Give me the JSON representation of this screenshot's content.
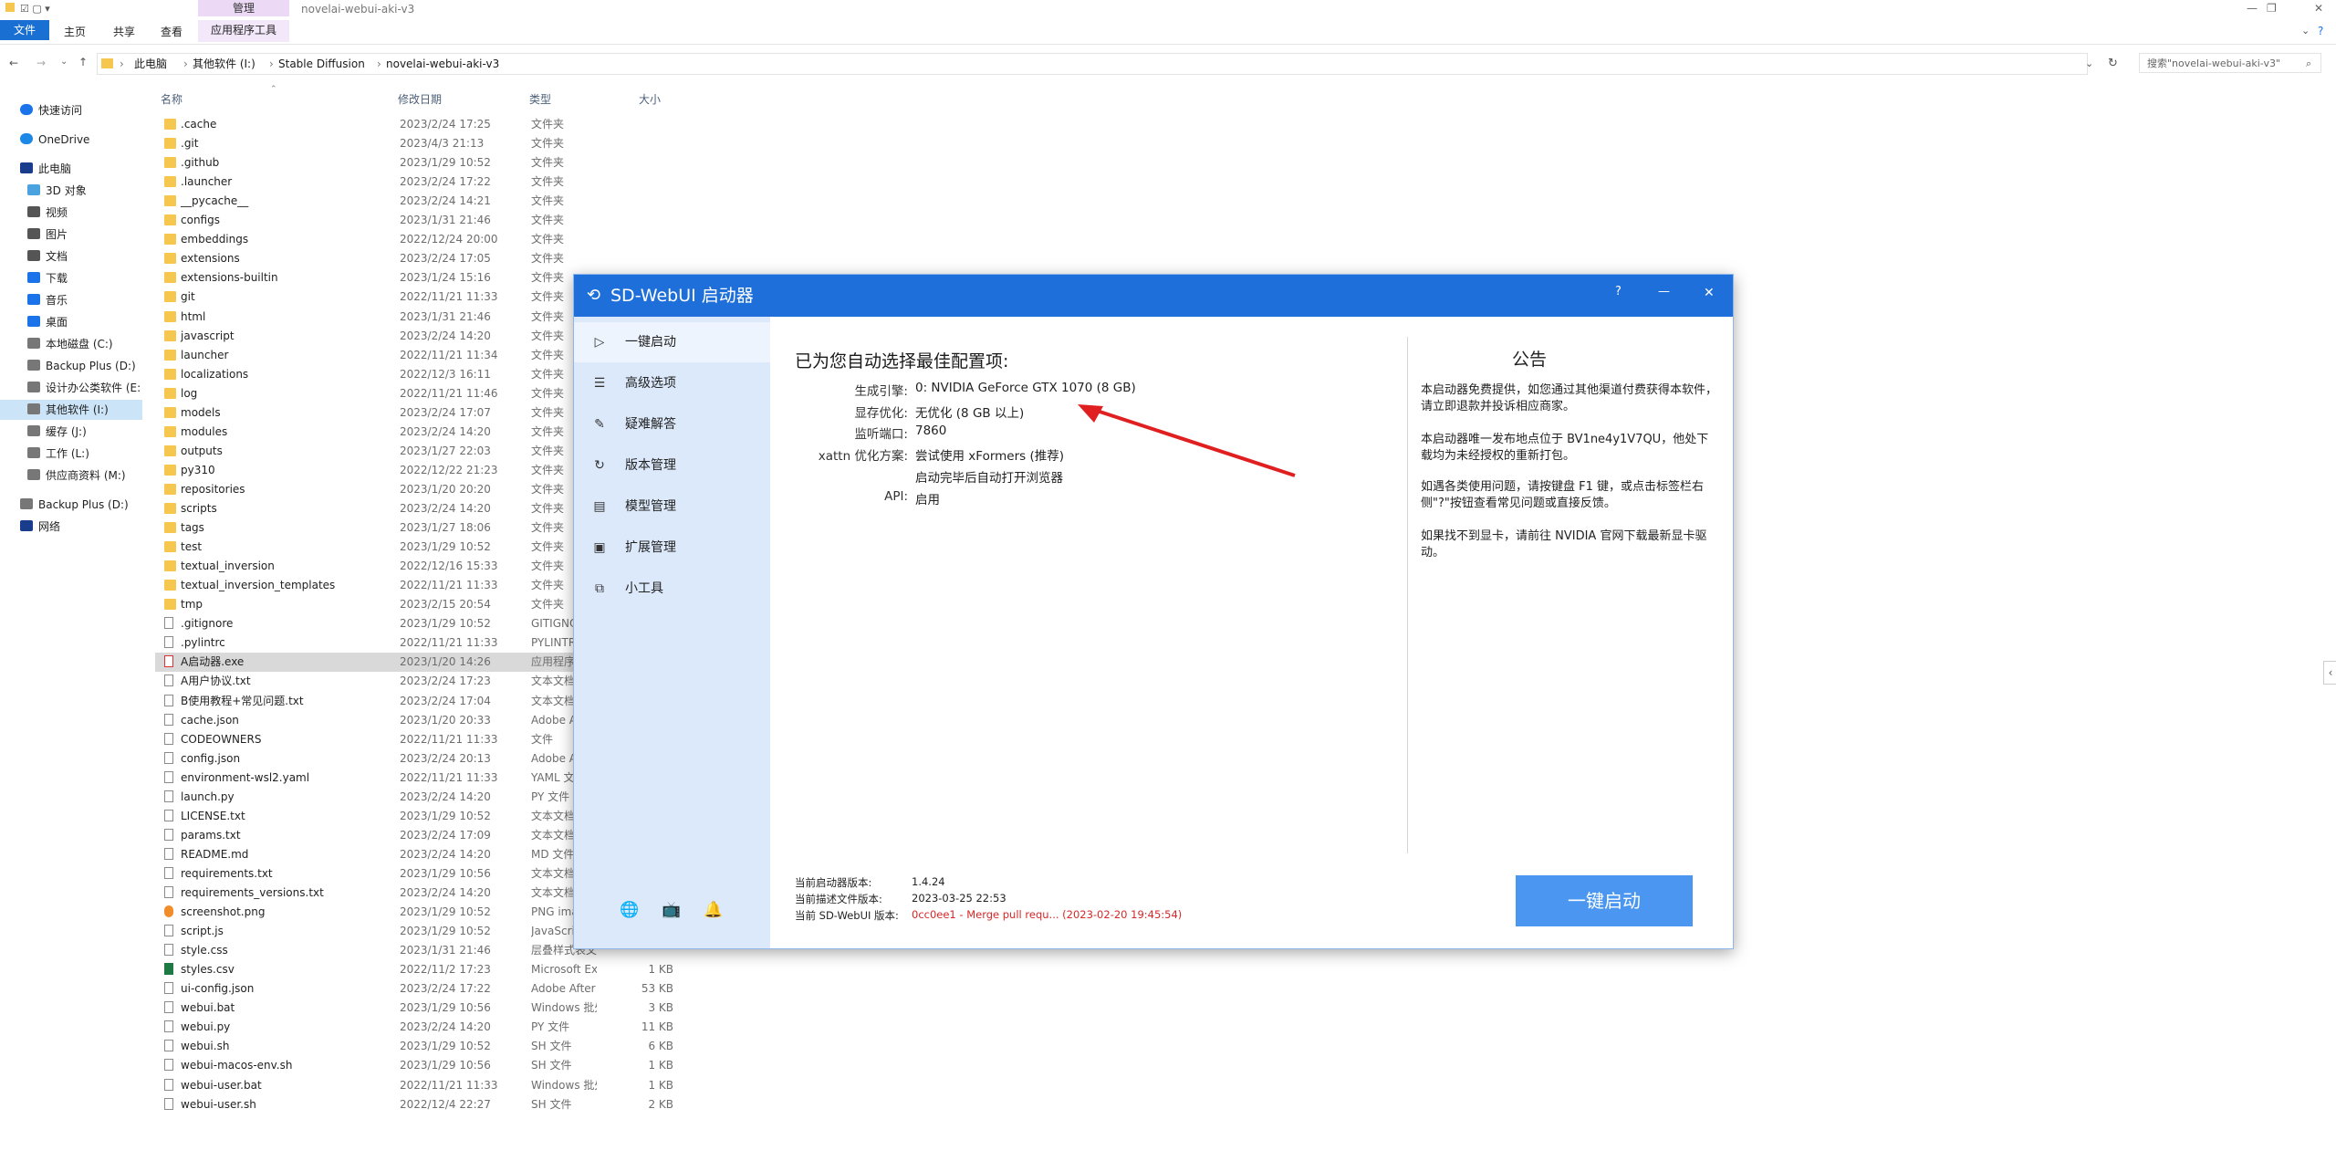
{
  "titlebar": {
    "manage_tab": "管理",
    "path_title": "novelai-webui-aki-v3"
  },
  "ribbon": {
    "tabs": [
      "文件",
      "主页",
      "共享",
      "查看",
      "应用程序工具"
    ]
  },
  "address": {
    "crumbs": [
      "此电脑",
      "其他软件 (I:)",
      "Stable Diffusion",
      "novelai-webui-aki-v3"
    ],
    "search_placeholder": "搜索\"novelai-webui-aki-v3\""
  },
  "nav": {
    "items": [
      {
        "label": "快速访问",
        "icon": "star-icon",
        "color": "#1a73e8"
      },
      {
        "label": "OneDrive",
        "icon": "cloud-icon",
        "color": "#1e88e5"
      },
      {
        "label": "此电脑",
        "icon": "pc-icon",
        "color": "#1a3c8c"
      },
      {
        "label": "3D 对象",
        "icon": "cube-icon",
        "color": "#4aa3df"
      },
      {
        "label": "视频",
        "icon": "video-icon",
        "color": "#555"
      },
      {
        "label": "图片",
        "icon": "picture-icon",
        "color": "#555"
      },
      {
        "label": "文档",
        "icon": "document-icon",
        "color": "#555"
      },
      {
        "label": "下载",
        "icon": "download-icon",
        "color": "#1a73e8"
      },
      {
        "label": "音乐",
        "icon": "music-icon",
        "color": "#1a73e8"
      },
      {
        "label": "桌面",
        "icon": "desktop-icon",
        "color": "#1a73e8"
      },
      {
        "label": "本地磁盘 (C:)",
        "icon": "drive-icon",
        "color": "#777"
      },
      {
        "label": "Backup Plus (D:)",
        "icon": "drive-icon",
        "color": "#777"
      },
      {
        "label": "设计办公类软件 (E:",
        "icon": "drive-icon",
        "color": "#777"
      },
      {
        "label": "其他软件 (I:)",
        "icon": "drive-icon",
        "color": "#777"
      },
      {
        "label": "缓存 (J:)",
        "icon": "drive-icon",
        "color": "#777"
      },
      {
        "label": "工作 (L:)",
        "icon": "drive-icon",
        "color": "#777"
      },
      {
        "label": "供应商资料 (M:)",
        "icon": "drive-icon",
        "color": "#777"
      },
      {
        "label": "Backup Plus (D:)",
        "icon": "drive-icon",
        "color": "#777"
      },
      {
        "label": "网络",
        "icon": "network-icon",
        "color": "#1a3c8c"
      }
    ]
  },
  "columns": {
    "name": "名称",
    "date": "修改日期",
    "type": "类型",
    "size": "大小"
  },
  "files": [
    {
      "n": ".cache",
      "d": "2023/2/24 17:25",
      "t": "文件夹",
      "s": "",
      "k": "folder"
    },
    {
      "n": ".git",
      "d": "2023/4/3 21:13",
      "t": "文件夹",
      "s": "",
      "k": "folder"
    },
    {
      "n": ".github",
      "d": "2023/1/29 10:52",
      "t": "文件夹",
      "s": "",
      "k": "folder"
    },
    {
      "n": ".launcher",
      "d": "2023/2/24 17:22",
      "t": "文件夹",
      "s": "",
      "k": "folder"
    },
    {
      "n": "__pycache__",
      "d": "2023/2/24 14:21",
      "t": "文件夹",
      "s": "",
      "k": "folder"
    },
    {
      "n": "configs",
      "d": "2023/1/31 21:46",
      "t": "文件夹",
      "s": "",
      "k": "folder"
    },
    {
      "n": "embeddings",
      "d": "2022/12/24 20:00",
      "t": "文件夹",
      "s": "",
      "k": "folder"
    },
    {
      "n": "extensions",
      "d": "2023/2/24 17:05",
      "t": "文件夹",
      "s": "",
      "k": "folder"
    },
    {
      "n": "extensions-builtin",
      "d": "2023/1/24 15:16",
      "t": "文件夹",
      "s": "",
      "k": "folder"
    },
    {
      "n": "git",
      "d": "2022/11/21 11:33",
      "t": "文件夹",
      "s": "",
      "k": "folder"
    },
    {
      "n": "html",
      "d": "2023/1/31 21:46",
      "t": "文件夹",
      "s": "",
      "k": "folder"
    },
    {
      "n": "javascript",
      "d": "2023/2/24 14:20",
      "t": "文件夹",
      "s": "",
      "k": "folder"
    },
    {
      "n": "launcher",
      "d": "2022/11/21 11:34",
      "t": "文件夹",
      "s": "",
      "k": "folder"
    },
    {
      "n": "localizations",
      "d": "2022/12/3 16:11",
      "t": "文件夹",
      "s": "",
      "k": "folder"
    },
    {
      "n": "log",
      "d": "2022/11/21 11:46",
      "t": "文件夹",
      "s": "",
      "k": "folder"
    },
    {
      "n": "models",
      "d": "2023/2/24 17:07",
      "t": "文件夹",
      "s": "",
      "k": "folder"
    },
    {
      "n": "modules",
      "d": "2023/2/24 14:20",
      "t": "文件夹",
      "s": "",
      "k": "folder"
    },
    {
      "n": "outputs",
      "d": "2023/1/27 22:03",
      "t": "文件夹",
      "s": "",
      "k": "folder"
    },
    {
      "n": "py310",
      "d": "2022/12/22 21:23",
      "t": "文件夹",
      "s": "",
      "k": "folder"
    },
    {
      "n": "repositories",
      "d": "2023/1/20 20:20",
      "t": "文件夹",
      "s": "",
      "k": "folder"
    },
    {
      "n": "scripts",
      "d": "2023/2/24 14:20",
      "t": "文件夹",
      "s": "",
      "k": "folder"
    },
    {
      "n": "tags",
      "d": "2023/1/27 18:06",
      "t": "文件夹",
      "s": "",
      "k": "folder"
    },
    {
      "n": "test",
      "d": "2023/1/29 10:52",
      "t": "文件夹",
      "s": "",
      "k": "folder"
    },
    {
      "n": "textual_inversion",
      "d": "2022/12/16 15:33",
      "t": "文件夹",
      "s": "",
      "k": "folder"
    },
    {
      "n": "textual_inversion_templates",
      "d": "2022/11/21 11:33",
      "t": "文件夹",
      "s": "",
      "k": "folder"
    },
    {
      "n": "tmp",
      "d": "2023/2/15 20:54",
      "t": "文件夹",
      "s": "",
      "k": "folder"
    },
    {
      "n": ".gitignore",
      "d": "2023/1/29 10:52",
      "t": "GITIGNO",
      "s": "",
      "k": "file"
    },
    {
      "n": ".pylintrc",
      "d": "2022/11/21 11:33",
      "t": "PYLINTR",
      "s": "",
      "k": "file"
    },
    {
      "n": "A启动器.exe",
      "d": "2023/1/20 14:26",
      "t": "应用程序",
      "s": "",
      "k": "exe"
    },
    {
      "n": "A用户协议.txt",
      "d": "2023/2/24 17:23",
      "t": "文本文档",
      "s": "",
      "k": "file"
    },
    {
      "n": "B使用教程+常见问题.txt",
      "d": "2023/2/24 17:04",
      "t": "文本文档",
      "s": "",
      "k": "file"
    },
    {
      "n": "cache.json",
      "d": "2023/1/20 20:33",
      "t": "Adobe A",
      "s": "",
      "k": "file"
    },
    {
      "n": "CODEOWNERS",
      "d": "2022/11/21 11:33",
      "t": "文件",
      "s": "",
      "k": "file"
    },
    {
      "n": "config.json",
      "d": "2023/2/24 20:13",
      "t": "Adobe A",
      "s": "",
      "k": "file"
    },
    {
      "n": "environment-wsl2.yaml",
      "d": "2022/11/21 11:33",
      "t": "YAML 文",
      "s": "",
      "k": "file"
    },
    {
      "n": "launch.py",
      "d": "2023/2/24 14:20",
      "t": "PY 文件",
      "s": "",
      "k": "file"
    },
    {
      "n": "LICENSE.txt",
      "d": "2023/1/29 10:52",
      "t": "文本文档",
      "s": "",
      "k": "file"
    },
    {
      "n": "params.txt",
      "d": "2023/2/24 17:09",
      "t": "文本文档",
      "s": "",
      "k": "file"
    },
    {
      "n": "README.md",
      "d": "2023/2/24 14:20",
      "t": "MD 文件",
      "s": "",
      "k": "file"
    },
    {
      "n": "requirements.txt",
      "d": "2023/1/29 10:56",
      "t": "文本文档",
      "s": "",
      "k": "file"
    },
    {
      "n": "requirements_versions.txt",
      "d": "2023/2/24 14:20",
      "t": "文本文档",
      "s": "",
      "k": "file"
    },
    {
      "n": "screenshot.png",
      "d": "2023/1/29 10:52",
      "t": "PNG ima",
      "s": "",
      "k": "png"
    },
    {
      "n": "script.js",
      "d": "2023/1/29 10:52",
      "t": "JavaScri",
      "s": "",
      "k": "file"
    },
    {
      "n": "style.css",
      "d": "2023/1/31 21:46",
      "t": "层叠样式表文档",
      "s": "",
      "k": "file"
    },
    {
      "n": "styles.csv",
      "d": "2022/11/2 17:23",
      "t": "Microsoft Excel ...",
      "s": "1 KB",
      "k": "csv"
    },
    {
      "n": "ui-config.json",
      "d": "2023/2/24 17:22",
      "t": "Adobe After Effe...",
      "s": "53 KB",
      "k": "file"
    },
    {
      "n": "webui.bat",
      "d": "2023/1/29 10:56",
      "t": "Windows 批处理...",
      "s": "3 KB",
      "k": "file"
    },
    {
      "n": "webui.py",
      "d": "2023/2/24 14:20",
      "t": "PY 文件",
      "s": "11 KB",
      "k": "file"
    },
    {
      "n": "webui.sh",
      "d": "2023/1/29 10:52",
      "t": "SH 文件",
      "s": "6 KB",
      "k": "file"
    },
    {
      "n": "webui-macos-env.sh",
      "d": "2023/1/29 10:56",
      "t": "SH 文件",
      "s": "1 KB",
      "k": "file"
    },
    {
      "n": "webui-user.bat",
      "d": "2022/11/21 11:33",
      "t": "Windows 批处理...",
      "s": "1 KB",
      "k": "file"
    },
    {
      "n": "webui-user.sh",
      "d": "2022/12/4 22:27",
      "t": "SH 文件",
      "s": "2 KB",
      "k": "file"
    }
  ],
  "dialog": {
    "title": "SD-WebUI 启动器",
    "help": "?",
    "minimize": "—",
    "close": "✕",
    "sidebar": [
      {
        "label": "一键启动",
        "icon": "▷"
      },
      {
        "label": "高级选项",
        "icon": "☰"
      },
      {
        "label": "疑难解答",
        "icon": "✎"
      },
      {
        "label": "版本管理",
        "icon": "↻"
      },
      {
        "label": "模型管理",
        "icon": "▤"
      },
      {
        "label": "扩展管理",
        "icon": "▣"
      },
      {
        "label": "小工具",
        "icon": "⧉"
      }
    ],
    "config_title": "已为您自动选择最佳配置项:",
    "config": [
      {
        "k": "生成引擎:",
        "v": "0: NVIDIA GeForce GTX 1070 (8 GB)"
      },
      {
        "k": "显存优化:",
        "v": "无优化 (8 GB 以上)"
      },
      {
        "k": "监听端口:",
        "v": "7860"
      },
      {
        "k": "xattn 优化方案:",
        "v": "尝试使用 xFormers (推荐)"
      },
      {
        "k": "",
        "v": "启动完毕后自动打开浏览器"
      },
      {
        "k": "API:",
        "v": "启用"
      }
    ],
    "notice_title": "公告",
    "notice": [
      "本启动器免费提供，如您通过其他渠道付费获得本软件，请立即退款并投诉相应商家。",
      "本启动器唯一发布地点位于 BV1ne4y1V7QU，他处下载均为未经授权的重新打包。",
      "如遇各类使用问题，请按键盘 F1 键，或点击标签栏右侧\"?\"按钮查看常见问题或直接反馈。",
      "如果找不到显卡，请前往 NVIDIA 官网下载最新显卡驱动。"
    ],
    "versions": [
      {
        "k": "当前启动器版本:",
        "v": "1.4.24",
        "c": "#222"
      },
      {
        "k": "当前描述文件版本:",
        "v": "2023-03-25 22:53",
        "c": "#222"
      },
      {
        "k": "当前 SD-WebUI 版本:",
        "v": "0cc0ee1 - Merge pull requ... (2023-02-20 19:45:54)",
        "c": "#d62828"
      }
    ],
    "launch": "一键启动",
    "accent": "#1e6fd9"
  }
}
